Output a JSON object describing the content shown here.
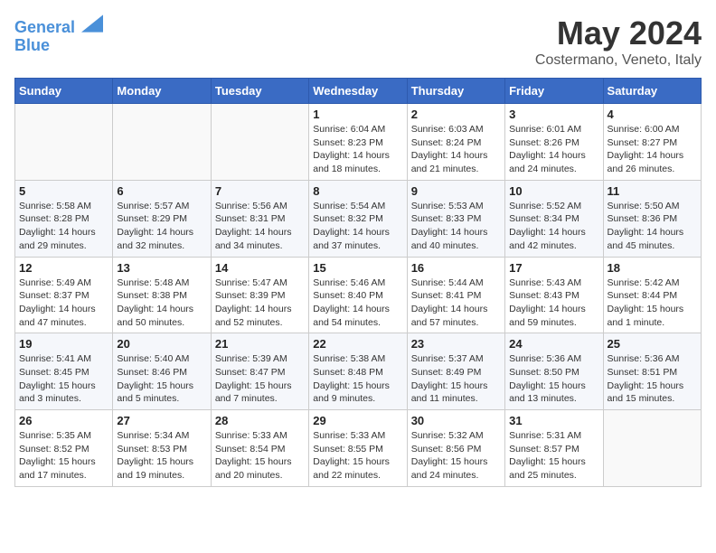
{
  "logo": {
    "line1": "General",
    "line2": "Blue"
  },
  "title": "May 2024",
  "location": "Costermano, Veneto, Italy",
  "weekdays": [
    "Sunday",
    "Monday",
    "Tuesday",
    "Wednesday",
    "Thursday",
    "Friday",
    "Saturday"
  ],
  "weeks": [
    [
      {
        "day": "",
        "info": ""
      },
      {
        "day": "",
        "info": ""
      },
      {
        "day": "",
        "info": ""
      },
      {
        "day": "1",
        "info": "Sunrise: 6:04 AM\nSunset: 8:23 PM\nDaylight: 14 hours\nand 18 minutes."
      },
      {
        "day": "2",
        "info": "Sunrise: 6:03 AM\nSunset: 8:24 PM\nDaylight: 14 hours\nand 21 minutes."
      },
      {
        "day": "3",
        "info": "Sunrise: 6:01 AM\nSunset: 8:26 PM\nDaylight: 14 hours\nand 24 minutes."
      },
      {
        "day": "4",
        "info": "Sunrise: 6:00 AM\nSunset: 8:27 PM\nDaylight: 14 hours\nand 26 minutes."
      }
    ],
    [
      {
        "day": "5",
        "info": "Sunrise: 5:58 AM\nSunset: 8:28 PM\nDaylight: 14 hours\nand 29 minutes."
      },
      {
        "day": "6",
        "info": "Sunrise: 5:57 AM\nSunset: 8:29 PM\nDaylight: 14 hours\nand 32 minutes."
      },
      {
        "day": "7",
        "info": "Sunrise: 5:56 AM\nSunset: 8:31 PM\nDaylight: 14 hours\nand 34 minutes."
      },
      {
        "day": "8",
        "info": "Sunrise: 5:54 AM\nSunset: 8:32 PM\nDaylight: 14 hours\nand 37 minutes."
      },
      {
        "day": "9",
        "info": "Sunrise: 5:53 AM\nSunset: 8:33 PM\nDaylight: 14 hours\nand 40 minutes."
      },
      {
        "day": "10",
        "info": "Sunrise: 5:52 AM\nSunset: 8:34 PM\nDaylight: 14 hours\nand 42 minutes."
      },
      {
        "day": "11",
        "info": "Sunrise: 5:50 AM\nSunset: 8:36 PM\nDaylight: 14 hours\nand 45 minutes."
      }
    ],
    [
      {
        "day": "12",
        "info": "Sunrise: 5:49 AM\nSunset: 8:37 PM\nDaylight: 14 hours\nand 47 minutes."
      },
      {
        "day": "13",
        "info": "Sunrise: 5:48 AM\nSunset: 8:38 PM\nDaylight: 14 hours\nand 50 minutes."
      },
      {
        "day": "14",
        "info": "Sunrise: 5:47 AM\nSunset: 8:39 PM\nDaylight: 14 hours\nand 52 minutes."
      },
      {
        "day": "15",
        "info": "Sunrise: 5:46 AM\nSunset: 8:40 PM\nDaylight: 14 hours\nand 54 minutes."
      },
      {
        "day": "16",
        "info": "Sunrise: 5:44 AM\nSunset: 8:41 PM\nDaylight: 14 hours\nand 57 minutes."
      },
      {
        "day": "17",
        "info": "Sunrise: 5:43 AM\nSunset: 8:43 PM\nDaylight: 14 hours\nand 59 minutes."
      },
      {
        "day": "18",
        "info": "Sunrise: 5:42 AM\nSunset: 8:44 PM\nDaylight: 15 hours\nand 1 minute."
      }
    ],
    [
      {
        "day": "19",
        "info": "Sunrise: 5:41 AM\nSunset: 8:45 PM\nDaylight: 15 hours\nand 3 minutes."
      },
      {
        "day": "20",
        "info": "Sunrise: 5:40 AM\nSunset: 8:46 PM\nDaylight: 15 hours\nand 5 minutes."
      },
      {
        "day": "21",
        "info": "Sunrise: 5:39 AM\nSunset: 8:47 PM\nDaylight: 15 hours\nand 7 minutes."
      },
      {
        "day": "22",
        "info": "Sunrise: 5:38 AM\nSunset: 8:48 PM\nDaylight: 15 hours\nand 9 minutes."
      },
      {
        "day": "23",
        "info": "Sunrise: 5:37 AM\nSunset: 8:49 PM\nDaylight: 15 hours\nand 11 minutes."
      },
      {
        "day": "24",
        "info": "Sunrise: 5:36 AM\nSunset: 8:50 PM\nDaylight: 15 hours\nand 13 minutes."
      },
      {
        "day": "25",
        "info": "Sunrise: 5:36 AM\nSunset: 8:51 PM\nDaylight: 15 hours\nand 15 minutes."
      }
    ],
    [
      {
        "day": "26",
        "info": "Sunrise: 5:35 AM\nSunset: 8:52 PM\nDaylight: 15 hours\nand 17 minutes."
      },
      {
        "day": "27",
        "info": "Sunrise: 5:34 AM\nSunset: 8:53 PM\nDaylight: 15 hours\nand 19 minutes."
      },
      {
        "day": "28",
        "info": "Sunrise: 5:33 AM\nSunset: 8:54 PM\nDaylight: 15 hours\nand 20 minutes."
      },
      {
        "day": "29",
        "info": "Sunrise: 5:33 AM\nSunset: 8:55 PM\nDaylight: 15 hours\nand 22 minutes."
      },
      {
        "day": "30",
        "info": "Sunrise: 5:32 AM\nSunset: 8:56 PM\nDaylight: 15 hours\nand 24 minutes."
      },
      {
        "day": "31",
        "info": "Sunrise: 5:31 AM\nSunset: 8:57 PM\nDaylight: 15 hours\nand 25 minutes."
      },
      {
        "day": "",
        "info": ""
      }
    ]
  ]
}
